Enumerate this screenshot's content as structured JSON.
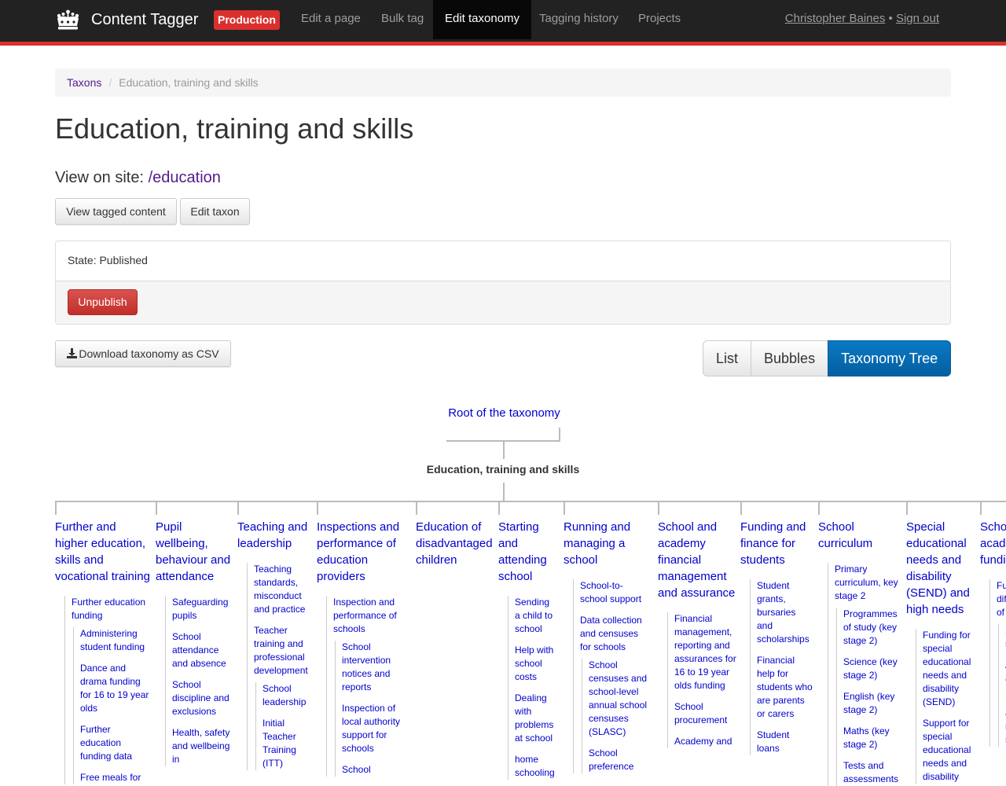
{
  "navbar": {
    "brand": "Content Tagger",
    "environment": "Production",
    "items": [
      {
        "label": "Edit a page",
        "active": false
      },
      {
        "label": "Bulk tag",
        "active": false
      },
      {
        "label": "Edit taxonomy",
        "active": true
      },
      {
        "label": "Tagging history",
        "active": false
      },
      {
        "label": "Projects",
        "active": false
      }
    ],
    "user_name": "Christopher Baines",
    "separator": "•",
    "sign_out": "Sign out"
  },
  "breadcrumb": {
    "parent": "Taxons",
    "separator": "/",
    "current": "Education, training and skills"
  },
  "page": {
    "title": "Education, training and skills",
    "view_on_site_label": "View on site:",
    "view_on_site_link": "/education",
    "buttons": {
      "view_tagged": "View tagged content",
      "edit_taxon": "Edit taxon"
    },
    "state_text": "State: Published",
    "unpublish": "Unpublish",
    "download_csv": "Download taxonomy as CSV",
    "views": [
      "List",
      "Bubbles",
      "Taxonomy Tree"
    ],
    "active_view": "Taxonomy Tree"
  },
  "colors": {
    "accent": "#d9302e",
    "link": "#0000cc",
    "visited": "#551a8b",
    "active_view": "#0a7ac4"
  },
  "tree": {
    "root": "Root of the taxonomy",
    "current": "Education, training and skills",
    "columns": [
      {
        "title": "Further and higher education, skills and vocational training",
        "children": [
          {
            "title": "Further education funding",
            "children": [
              "Administering student funding",
              "Dance and drama funding for 16 to 19 year olds",
              "Further education funding data",
              "Free meals for"
            ]
          }
        ]
      },
      {
        "title": "Pupil wellbeing, behaviour and attendance",
        "children": [
          {
            "title": "Safeguarding pupils"
          },
          {
            "title": "School attendance and absence"
          },
          {
            "title": "School discipline and exclusions"
          },
          {
            "title": "Health, safety and wellbeing in"
          }
        ]
      },
      {
        "title": "Teaching and leadership",
        "children": [
          {
            "title": "Teaching standards, misconduct and practice"
          },
          {
            "title": "Teacher training and professional development",
            "children": [
              "School leadership",
              "Initial Teacher Training (ITT)"
            ]
          }
        ]
      },
      {
        "title": "Inspections and performance of education providers",
        "children": [
          {
            "title": "Inspection and performance of schools",
            "children": [
              "School intervention notices and reports",
              "Inspection of local authority support for schools",
              "School"
            ]
          }
        ]
      },
      {
        "title": "Education of disadvantaged children",
        "children": []
      },
      {
        "title": "Starting and attending school",
        "children": [
          {
            "title": "Sending a child to school"
          },
          {
            "title": "Help with school costs"
          },
          {
            "title": "Dealing with problems at school"
          },
          {
            "title": "home schooling"
          }
        ]
      },
      {
        "title": "Running and managing a school",
        "children": [
          {
            "title": "School-to-school support"
          },
          {
            "title": "Data collection and censuses for schools",
            "children": [
              "School censuses and school-level annual school censuses (SLASC)",
              "School preference"
            ]
          }
        ]
      },
      {
        "title": "School and academy financial management and assurance",
        "children": [
          {
            "title": "Financial management, reporting and assurances for 16 to 19 year olds funding"
          },
          {
            "title": "School procurement"
          },
          {
            "title": "Academy and"
          }
        ]
      },
      {
        "title": "Funding and finance for students",
        "children": [
          {
            "title": "Student grants, bursaries and scholarships"
          },
          {
            "title": "Financial help for students who are parents or carers"
          },
          {
            "title": "Student loans"
          }
        ]
      },
      {
        "title": "School curriculum",
        "children": [
          {
            "title": "Primary curriculum, key stage 2",
            "children": [
              "Programmes of study (key stage 2)",
              "Science (key stage 2)",
              "English (key stage 2)",
              "Maths (key stage 2)",
              "Tests and assessments"
            ]
          }
        ]
      },
      {
        "title": "Special educational needs and disability (SEND) and high needs",
        "children": [
          {
            "title": "Funding for special educational needs and disability (SEND)"
          },
          {
            "title": "Support for special educational needs and disability"
          }
        ]
      },
      {
        "title": "School and academy funding",
        "children": [
          {
            "title": "Funding differences of secondary",
            "children": [
              "School sixth form",
              "Academy and free",
              "Local authority maintained schools"
            ]
          }
        ]
      }
    ]
  }
}
